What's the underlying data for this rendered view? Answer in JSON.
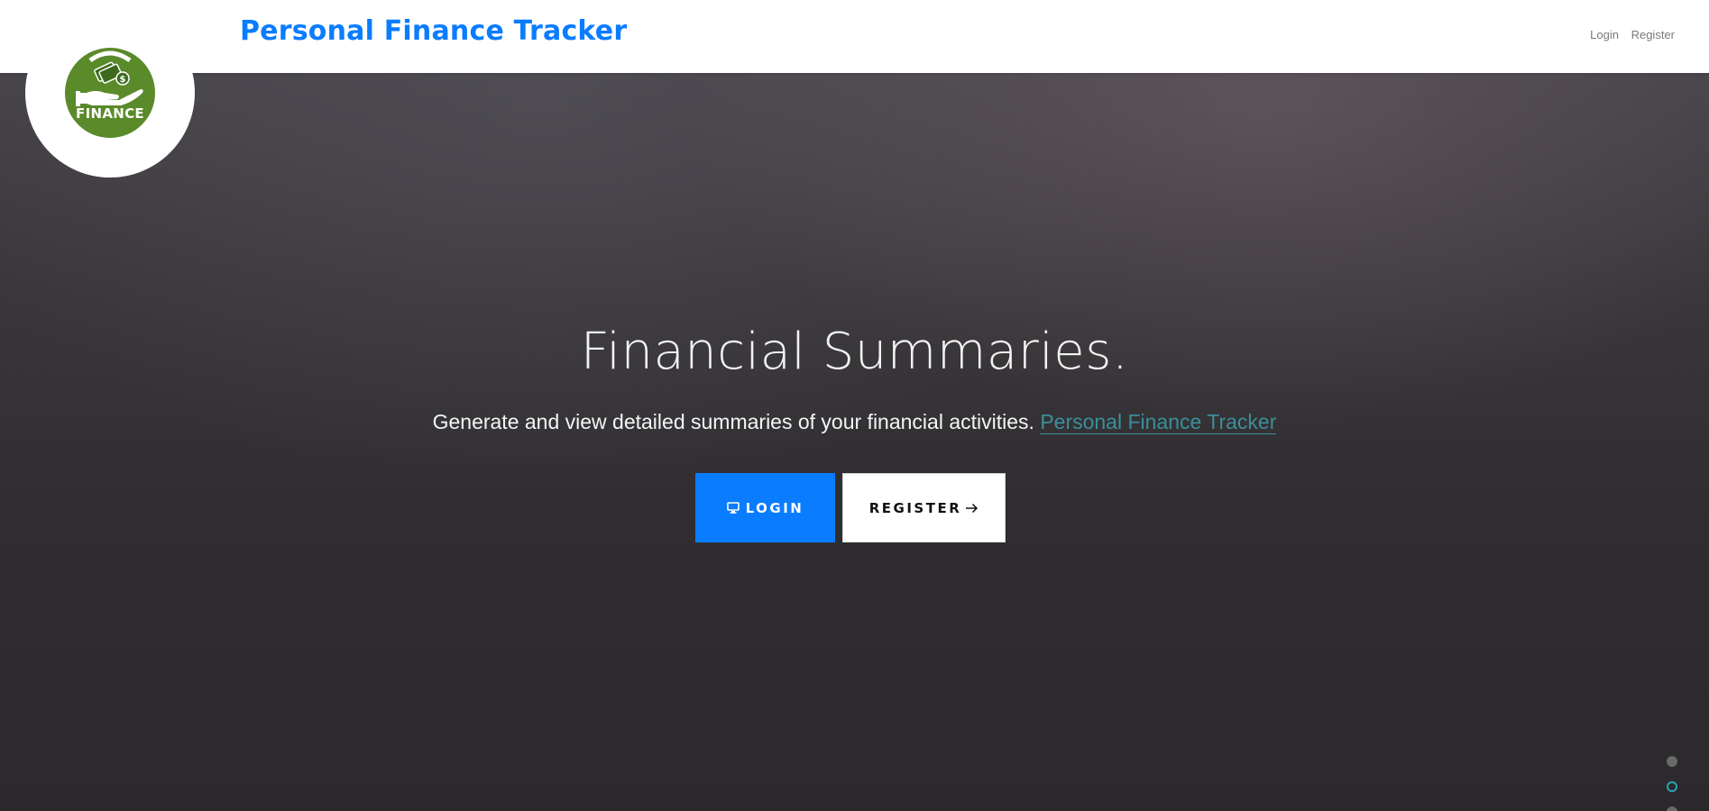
{
  "navbar": {
    "brand": "Personal Finance Tracker",
    "links": [
      "Login",
      "Register"
    ]
  },
  "logo": {
    "text": "FINANCE",
    "icon": "hand-holding-money-icon",
    "colors": {
      "badge": "#5a8a2a",
      "ring": "#ffffff"
    }
  },
  "hero": {
    "title": "Financial Summaries.",
    "subtitle_text": "Generate and view detailed summaries of your financial activities.",
    "subtitle_link": "Personal Finance Tracker",
    "buttons": {
      "login": {
        "label": "LOGIN",
        "icon": "monitor-icon"
      },
      "register": {
        "label": "REGISTER",
        "icon": "arrow-right-icon"
      }
    }
  },
  "slider": {
    "dots": 3,
    "active_index": 1
  },
  "colors": {
    "brand": "#0a7cff",
    "link_accent": "#3b8f9a",
    "hero_bg": "#2f2d30"
  }
}
